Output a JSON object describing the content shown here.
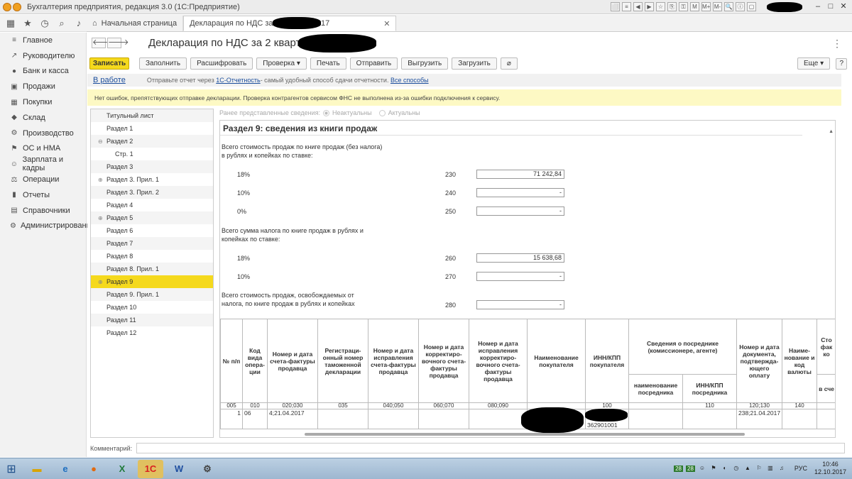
{
  "window": {
    "title": "Бухгалтерия предприятия, редакция 3.0  (1С:Предприятие)",
    "controls": [
      "⬜",
      "≡",
      "◀",
      "▶",
      "☆",
      "⎘",
      "⚿",
      "M",
      "M+",
      "M-",
      "🔍",
      "ⓘ",
      "▢"
    ]
  },
  "tabs": [
    {
      "label": "Начальная страница"
    },
    {
      "label": "Декларация по НДС за 2 квартал 2017"
    }
  ],
  "sidebar": {
    "items": [
      {
        "label": "Главное",
        "icon": "≡"
      },
      {
        "label": "Руководителю",
        "icon": "↗"
      },
      {
        "label": "Банк и касса",
        "icon": "●"
      },
      {
        "label": "Продажи",
        "icon": "▣"
      },
      {
        "label": "Покупки",
        "icon": "▦"
      },
      {
        "label": "Склад",
        "icon": "◆"
      },
      {
        "label": "Производство",
        "icon": "⚙"
      },
      {
        "label": "ОС и НМА",
        "icon": "⚑"
      },
      {
        "label": "Зарплата и кадры",
        "icon": "☺"
      },
      {
        "label": "Операции",
        "icon": "⚖"
      },
      {
        "label": "Отчеты",
        "icon": "▮"
      },
      {
        "label": "Справочники",
        "icon": "▤"
      },
      {
        "label": "Администрирование",
        "icon": "⚙"
      }
    ]
  },
  "document": {
    "title": "Декларация по НДС за 2 квартал 2017 г."
  },
  "toolbar": {
    "save": "Записать",
    "fill": "Заполнить",
    "decode": "Расшифровать",
    "check": "Проверка",
    "print": "Печать",
    "send": "Отправить",
    "export": "Выгрузить",
    "import": "Загрузить",
    "more": "Еще"
  },
  "infobar": {
    "status": "В работе",
    "text_before": "Отправьте отчет через",
    "link1": "1С-Отчетность",
    "text_middle": " - самый удобный способ сдачи отчетности.",
    "link2": "Все способы"
  },
  "warning": "Нет ошибок, препятствующих отправке декларации. Проверка контрагентов сервисом ФНС не выполнена из-за ошибки подключения к сервису.",
  "tree": {
    "items": [
      {
        "label": "Титульный лист",
        "expander": "",
        "sub": false
      },
      {
        "label": "Раздел 1",
        "expander": "",
        "sub": false
      },
      {
        "label": "Раздел 2",
        "expander": "⊖",
        "sub": false
      },
      {
        "label": "Стр. 1",
        "expander": "",
        "sub": true
      },
      {
        "label": "Раздел 3",
        "expander": "",
        "sub": false
      },
      {
        "label": "Раздел 3. Прил. 1",
        "expander": "⊕",
        "sub": false
      },
      {
        "label": "Раздел 3. Прил. 2",
        "expander": "",
        "sub": false
      },
      {
        "label": "Раздел 4",
        "expander": "",
        "sub": false
      },
      {
        "label": "Раздел 5",
        "expander": "⊕",
        "sub": false
      },
      {
        "label": "Раздел 6",
        "expander": "",
        "sub": false
      },
      {
        "label": "Раздел 7",
        "expander": "",
        "sub": false
      },
      {
        "label": "Раздел 8",
        "expander": "",
        "sub": false
      },
      {
        "label": "Раздел 8. Прил. 1",
        "expander": "",
        "sub": false
      },
      {
        "label": "Раздел 9",
        "expander": "⊕",
        "sub": false,
        "selected": true
      },
      {
        "label": "Раздел 9. Прил. 1",
        "expander": "",
        "sub": false
      },
      {
        "label": "Раздел 10",
        "expander": "",
        "sub": false
      },
      {
        "label": "Раздел 11",
        "expander": "",
        "sub": false
      },
      {
        "label": "Раздел 12",
        "expander": "",
        "sub": false
      }
    ]
  },
  "radio": {
    "label": "Ранее представленные сведения:",
    "opt1": "Неактуальны",
    "opt2": "Актуальны"
  },
  "form": {
    "section_title": "Раздел 9: сведения из книги продаж",
    "group1_label": "Всего стоимость продаж по книге продаж (без налога)\nв рублях и копейках по ставке:",
    "group2_label": "Всего сумма налога по книге продаж в рублях и\nкопейках по ставке:",
    "group3_label": "Всего стоимость продаж, освобождаемых от\nналога, по книге продаж в рублях и копейках",
    "rows": [
      {
        "rate": "18%",
        "code": "230",
        "value": "71 242,84"
      },
      {
        "rate": "10%",
        "code": "240",
        "value": "-"
      },
      {
        "rate": "0%",
        "code": "250",
        "value": "-"
      },
      {
        "rate": "18%",
        "code": "260",
        "value": "15 638,68"
      },
      {
        "rate": "10%",
        "code": "270",
        "value": "-"
      },
      {
        "rate": "",
        "code": "280",
        "value": "-"
      }
    ]
  },
  "table": {
    "headers": [
      "№ п/п",
      "Код вида опера-ции",
      "Номер и дата счета-фактуры продавца",
      "Регистраци-онный номер таможенной декларации",
      "Номер и дата исправления счета-фактуры продавца",
      "Номер и дата корректиро-вочного счета-фактуры продавца",
      "Номер и дата исправления корректиро-вочного счета-фактуры продавца",
      "Наименование покупателя",
      "ИНН/КПП покупателя",
      "Сведения о посреднике (комиссионере, агенте)",
      "Номер и дата документа, подтвержда-ющего оплату",
      "Наиме-нование и код валюты",
      "Сто фак ко"
    ],
    "subheaders": [
      "наименование посредника",
      "ИНН/КПП посредника",
      "в сче"
    ],
    "codes": [
      "005",
      "010",
      "020;030",
      "035",
      "040;050",
      "060;070",
      "080;090",
      "",
      "100",
      "",
      "110",
      "120;130",
      "140",
      ""
    ],
    "row": [
      "1",
      "06",
      "4;21.04.2017",
      "",
      "",
      "",
      "",
      "",
      "362901001",
      "",
      "",
      "238;21.04.2017",
      "",
      ""
    ]
  },
  "comment_label": "Комментарий:",
  "taskbar": {
    "tray_num1": "28",
    "tray_num2": "28",
    "lang": "РУС",
    "time": "10:46",
    "date": "12.10.2017"
  }
}
